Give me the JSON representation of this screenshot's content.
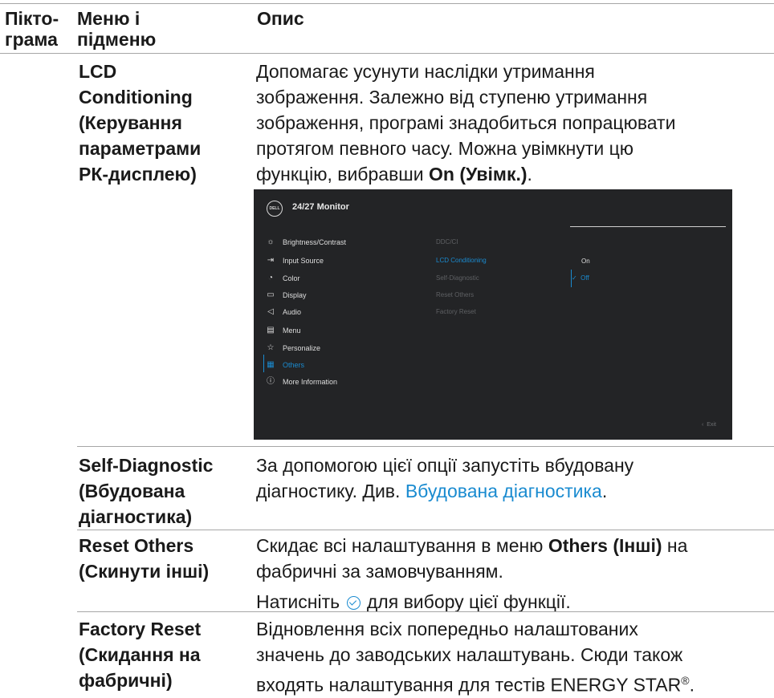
{
  "header": {
    "col_icon": [
      "Пікто-",
      "грама"
    ],
    "col_menu": [
      "Меню і",
      "підменю"
    ],
    "col_desc": "Опис"
  },
  "rows": [
    {
      "menu_lines": [
        "LCD",
        "Conditioning",
        "(Керування",
        "параметрами",
        "РК-дисплею)"
      ],
      "desc_lines": [
        "Допомагає усунути наслідки утримання",
        "зображення. Залежно від ступеню утримання",
        "зображення, програмі знадобиться попрацювати",
        "протягом певного часу. Можна увімкнути цю"
      ],
      "desc_last_prefix": "функцію, вибравши ",
      "desc_last_bold": "On (Увімк.)",
      "desc_last_suffix": "."
    },
    {
      "menu_lines": [
        "Self-Diagnostic",
        "(Вбудована",
        "діагностика)"
      ],
      "desc_line1": "За допомогою цієї опції запустіть вбудовану",
      "desc_line2_prefix": "діагностику. Див. ",
      "desc_line2_link": "Вбудована діагностика",
      "desc_line2_suffix": "."
    },
    {
      "menu_lines": [
        "Reset Others",
        "(Скинути інші)"
      ],
      "desc_line1_prefix": "Скидає всі налаштування в меню ",
      "desc_line1_bold": "Others (Інші)",
      "desc_line1_suffix": " на",
      "desc_line2": "фабричні за замовчуванням.",
      "desc_line3_prefix": "Натисніть ",
      "desc_line3_suffix": " для вибору цієї функції."
    },
    {
      "menu_lines": [
        "Factory Reset",
        "(Скидання на",
        "фабричні)"
      ],
      "desc_lines": [
        "Відновлення всіх попередньо налаштованих",
        "значень до заводських налаштувань. Сюди також"
      ],
      "desc_last": "входять налаштування для тестів ENERGY STAR",
      "desc_last_sup": "®",
      "desc_last_suffix": "."
    }
  ],
  "osd": {
    "logo": "DELL",
    "title": "24/27 Monitor",
    "menu": [
      {
        "icon": "brightness-icon",
        "glyph": "☼",
        "label": "Brightness/Contrast"
      },
      {
        "icon": "input-source-icon",
        "glyph": "⇥",
        "label": "Input Source"
      },
      {
        "icon": "color-icon",
        "glyph": "◔",
        "label": "Color"
      },
      {
        "icon": "display-icon",
        "glyph": "▭",
        "label": "Display"
      },
      {
        "icon": "audio-icon",
        "glyph": "◁",
        "label": "Audio"
      },
      {
        "icon": "menu-icon",
        "glyph": "▤",
        "label": "Menu"
      },
      {
        "icon": "star-icon",
        "glyph": "☆",
        "label": "Personalize"
      },
      {
        "icon": "others-icon",
        "glyph": "▦",
        "label": "Others"
      },
      {
        "icon": "info-icon",
        "glyph": "ⓘ",
        "label": "More Information"
      }
    ],
    "selected_menu": "Others",
    "submenu": [
      "DDC/CI",
      "LCD Conditioning",
      "Self-Diagnostic",
      "Reset Others",
      "Factory Reset"
    ],
    "active_submenu": "LCD Conditioning",
    "options": [
      "On",
      "Off"
    ],
    "selected_option": "Off",
    "check": "✓",
    "exit_label": "Exit",
    "exit_glyph": "‹",
    "colors": {
      "background": "#232426",
      "accent": "#1a8bd0",
      "inactive": "#5e6063"
    }
  }
}
